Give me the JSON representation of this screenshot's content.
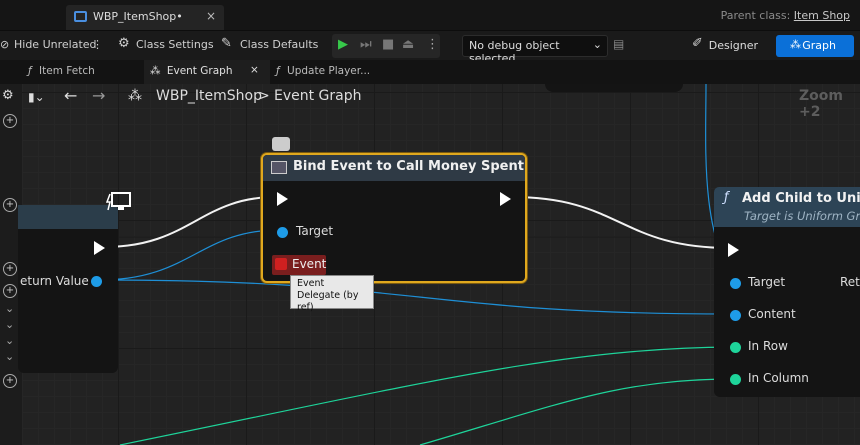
{
  "asset_tab": {
    "label": "WBP_ItemShop•",
    "close": "×"
  },
  "parent_class": {
    "prefix": "Parent class:",
    "name": "Item Shop"
  },
  "toolbar": {
    "hide_unrelated": "Hide Unrelated",
    "class_settings": "Class Settings",
    "class_defaults": "Class Defaults",
    "debug_select": "No debug object selected",
    "designer": "Designer",
    "graph": "Graph"
  },
  "doc_tabs": [
    {
      "label": "Item Fetch"
    },
    {
      "label": "Event Graph",
      "close": "×"
    },
    {
      "label": "Update Player..."
    }
  ],
  "breadcrumb": {
    "root": "WBP_ItemShop",
    "sep": ">",
    "leaf": "Event Graph"
  },
  "zoom_label": "Zoom +2",
  "bind_node": {
    "title": "Bind Event to Call Money Spent",
    "pins": {
      "target": "Target",
      "event": "Event"
    }
  },
  "left_node": {
    "pin": "eturn Value"
  },
  "right_node": {
    "title": "Add Child to Unifo",
    "subtitle": "Target is Uniform Gr",
    "pins": {
      "target": "Target",
      "return": "Ret",
      "content": "Content",
      "in_row": "In Row",
      "in_column": "In Column"
    }
  },
  "tooltip": {
    "line1": "Event",
    "line2": "Delegate (by ref)"
  },
  "colors": {
    "accent": "#0b70d8",
    "selected_node": "#e0a81e",
    "object_pin": "#1e9ce8",
    "int_pin": "#1ed49a",
    "delegate_pin": "#d02020"
  }
}
